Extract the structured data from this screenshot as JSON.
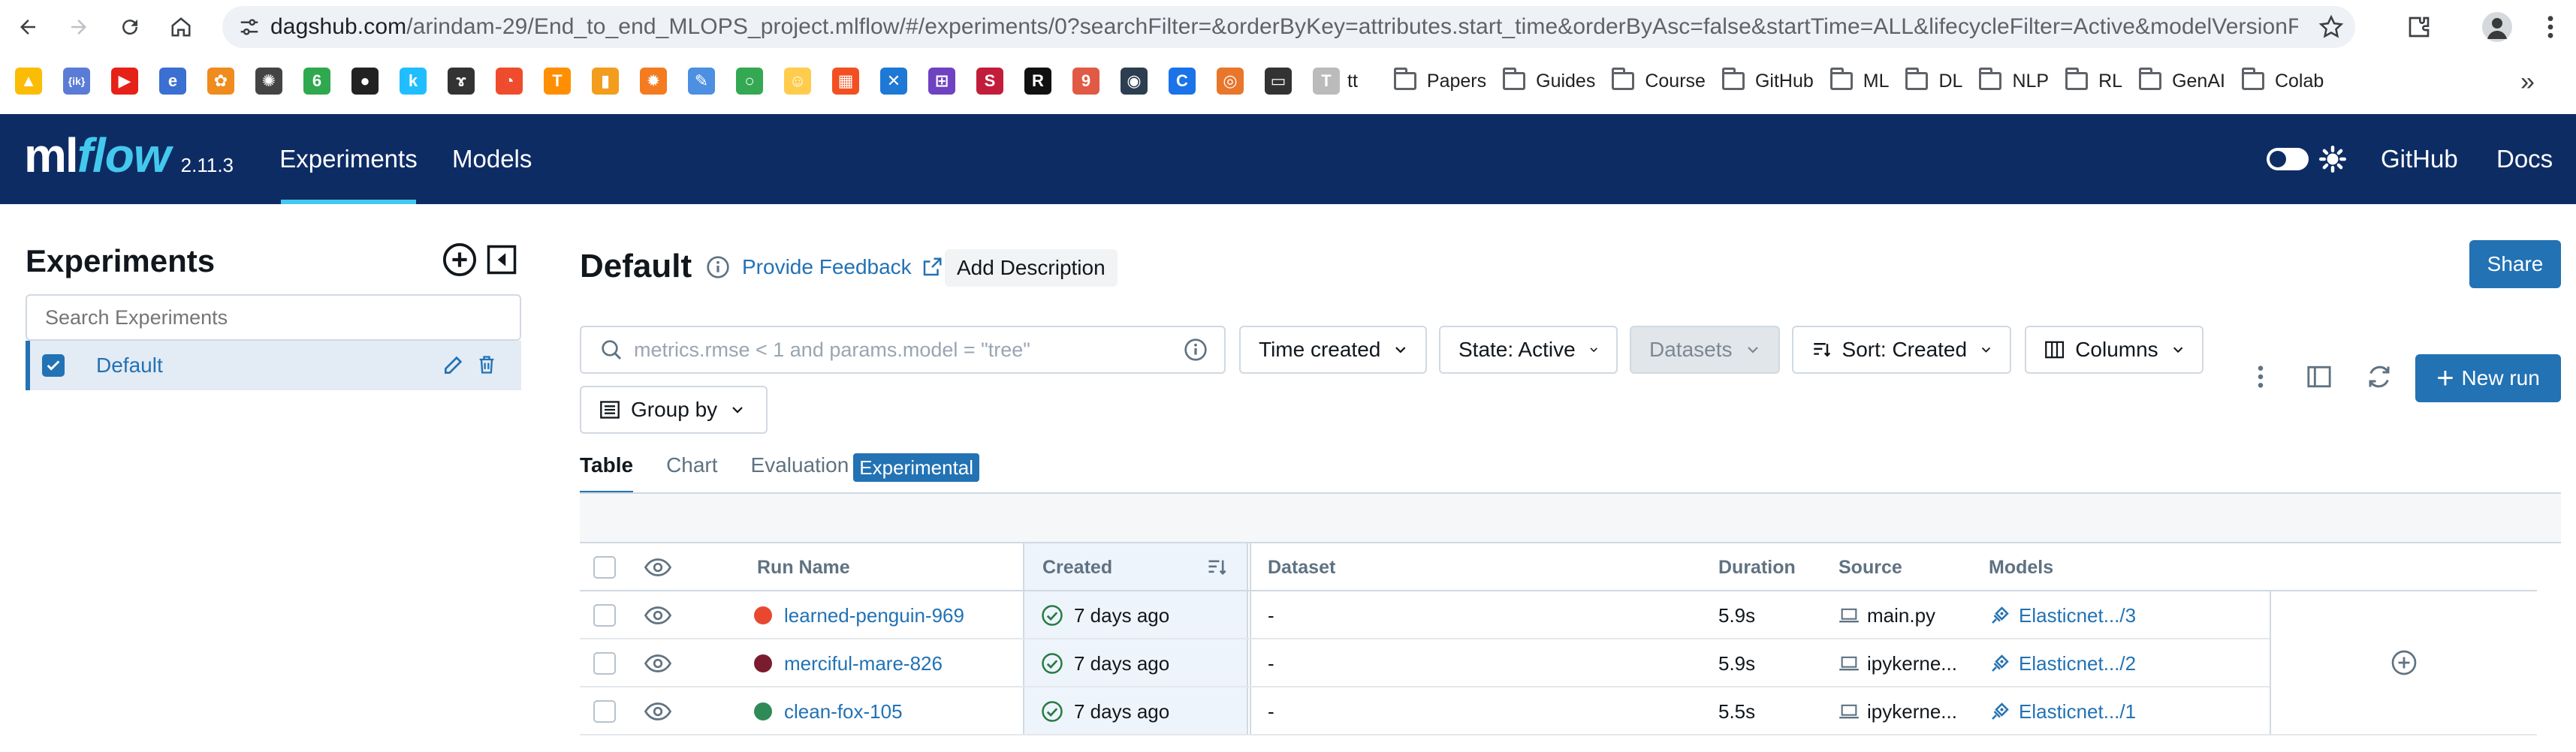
{
  "browser": {
    "url_host": "dagshub.com",
    "url_path": "/arindam-29/End_to_end_MLOPS_project.mlflow/#/experiments/0?searchFilter=&orderByKey=attributes.start_time&orderByAsc=false&startTime=ALL&lifecycleFilter=Active&modelVersionFil...",
    "bookmarks_apps": [
      {
        "name": "google-drive",
        "color": "#fbbc04",
        "glyph": "▲"
      },
      {
        "name": "ik",
        "color": "#5b7cd6",
        "glyph": "{ik}"
      },
      {
        "name": "youtube",
        "color": "#e62117",
        "glyph": "▶"
      },
      {
        "name": "edge-app",
        "color": "#3b6fd1",
        "glyph": "e"
      },
      {
        "name": "orange-app",
        "color": "#f08b1d",
        "glyph": "✿"
      },
      {
        "name": "openai",
        "color": "#444444",
        "glyph": "✺"
      },
      {
        "name": "green-app",
        "color": "#2fa84f",
        "glyph": "6"
      },
      {
        "name": "github",
        "color": "#222222",
        "glyph": "●"
      },
      {
        "name": "kaggle",
        "color": "#20beff",
        "glyph": "k"
      },
      {
        "name": "alpaca",
        "color": "#333333",
        "glyph": "ɤ"
      },
      {
        "name": "pytorch",
        "color": "#ee4c2c",
        "glyph": "◔"
      },
      {
        "name": "tensorflow",
        "color": "#ff8f00",
        "glyph": "T"
      },
      {
        "name": "chart-app",
        "color": "#f29d1d",
        "glyph": "▮"
      },
      {
        "name": "settings-app",
        "color": "#f47b20",
        "glyph": "✹"
      },
      {
        "name": "notes-app",
        "color": "#4d8fe0",
        "glyph": "✎"
      },
      {
        "name": "ring-app",
        "color": "#34a853",
        "glyph": "○"
      },
      {
        "name": "hf",
        "color": "#ffcc4d",
        "glyph": "☺"
      },
      {
        "name": "ms-app",
        "color": "#f25022",
        "glyph": "▦"
      },
      {
        "name": "blue-x",
        "color": "#1e78d6",
        "glyph": "✕"
      },
      {
        "name": "purple-app",
        "color": "#6f42c1",
        "glyph": "⊞"
      },
      {
        "name": "red-s",
        "color": "#c21d3a",
        "glyph": "S"
      },
      {
        "name": "black-r",
        "color": "#111111",
        "glyph": "R"
      },
      {
        "name": "red-9",
        "color": "#e05a45",
        "glyph": "9"
      },
      {
        "name": "docker",
        "color": "#2c3e50",
        "glyph": "◉"
      },
      {
        "name": "blue-c",
        "color": "#1a73e8",
        "glyph": "C"
      },
      {
        "name": "orange-ring",
        "color": "#e8762b",
        "glyph": "◎"
      },
      {
        "name": "terminal",
        "color": "#333333",
        "glyph": "▭"
      },
      {
        "name": "ts-app",
        "color": "#bbbbbb",
        "glyph": "T"
      }
    ],
    "bookmark_tt": "tt",
    "bookmark_folders": [
      "Papers",
      "Guides",
      "Course",
      "GitHub",
      "ML",
      "DL",
      "NLP",
      "RL",
      "GenAI",
      "Colab"
    ]
  },
  "header": {
    "logo_ml": "ml",
    "logo_flow": "flow",
    "version": "2.11.3",
    "tabs": [
      "Experiments",
      "Models"
    ],
    "links": [
      "GitHub",
      "Docs"
    ]
  },
  "sidebar": {
    "title": "Experiments",
    "search_placeholder": "Search Experiments",
    "items": [
      {
        "label": "Default"
      }
    ]
  },
  "main": {
    "title": "Default",
    "feedback": "Provide Feedback",
    "add_description": "Add Description",
    "share": "Share",
    "search_placeholder": "metrics.rmse < 1 and params.model = \"tree\"",
    "filters": {
      "time_created": "Time created",
      "state": "State: Active",
      "datasets": "Datasets",
      "sort": "Sort: Created",
      "columns": "Columns",
      "group_by": "Group by"
    },
    "new_run": "New run",
    "tabs": [
      "Table",
      "Chart",
      "Evaluation"
    ],
    "experimental_badge": "Experimental"
  },
  "table": {
    "columns": [
      "Run Name",
      "Created",
      "Dataset",
      "Duration",
      "Source",
      "Models"
    ],
    "rows": [
      {
        "name": "learned-penguin-969",
        "color": "#e8482f",
        "created": "7 days ago",
        "dataset": "-",
        "duration": "5.9s",
        "source": "main.py",
        "model": "Elasticnet.../3"
      },
      {
        "name": "merciful-mare-826",
        "color": "#7b1c2e",
        "created": "7 days ago",
        "dataset": "-",
        "duration": "5.9s",
        "source": "ipykerne...",
        "model": "Elasticnet.../2"
      },
      {
        "name": "clean-fox-105",
        "color": "#2e8b57",
        "created": "7 days ago",
        "dataset": "-",
        "duration": "5.5s",
        "source": "ipykerne...",
        "model": "Elasticnet.../1"
      }
    ]
  }
}
